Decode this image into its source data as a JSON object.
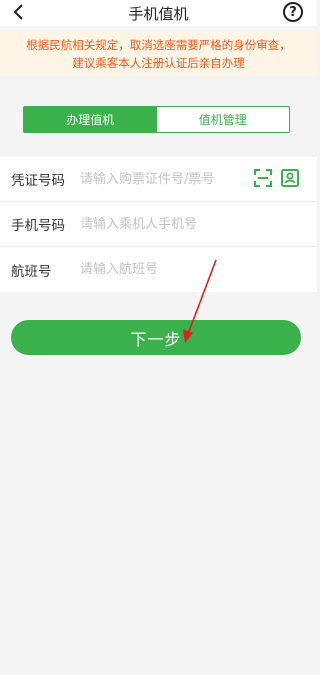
{
  "header": {
    "title": "手机值机",
    "back_icon": "chevron-left-icon",
    "help_icon": "question-circle-icon",
    "help_glyph": "?"
  },
  "notice": {
    "line1": "根据民航相关规定，取消选座需要严格的身份审查，",
    "line2": "建议乘客本人注册认证后亲自办理"
  },
  "tabs": [
    {
      "label": "办理值机",
      "active": true
    },
    {
      "label": "值机管理",
      "active": false
    }
  ],
  "form": {
    "id_label": "凭证号码",
    "id_placeholder": "请输入购票证件号/票号",
    "phone_label": "手机号码",
    "phone_placeholder": "请输入乘机人手机号",
    "flight_label": "航班号",
    "flight_placeholder": "请输入航班号"
  },
  "next_button": "下一步",
  "colors": {
    "accent": "#3ab14a",
    "notice_text": "#f05a1e",
    "notice_bg": "#fff5e6",
    "annotation": "#e02020"
  }
}
